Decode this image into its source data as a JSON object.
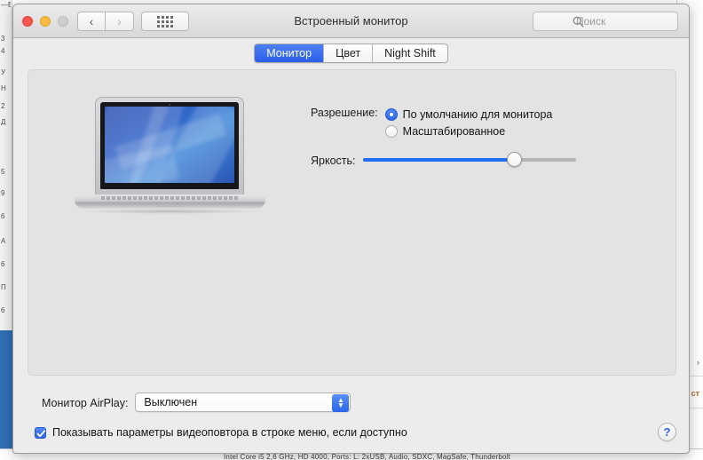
{
  "window": {
    "title": "Встроенный монитор",
    "traffic_lights": [
      "close",
      "minimize",
      "zoom"
    ],
    "nav": {
      "back_label": "‹",
      "forward_label": "›"
    },
    "grid_button_name": "show-all-preferences"
  },
  "search": {
    "placeholder": "Поиск",
    "icon": "search-icon"
  },
  "tabs": [
    {
      "label": "Монитор",
      "active": true
    },
    {
      "label": "Цвет",
      "active": false
    },
    {
      "label": "Night Shift",
      "active": false
    }
  ],
  "display_preview": {
    "device": "MacBook Pro",
    "wallpaper": "blue-abstract-waves"
  },
  "resolution": {
    "label": "Разрешение:",
    "options": [
      {
        "label": "По умолчанию для монитора",
        "selected": true
      },
      {
        "label": "Масштабированное",
        "selected": false
      }
    ]
  },
  "brightness": {
    "label": "Яркость:",
    "value_percent": 73,
    "min": 0,
    "max": 100
  },
  "airplay": {
    "label": "Монитор AirPlay:",
    "selected_value": "Выключен",
    "stepper_up_glyph": "▲",
    "stepper_down_glyph": "▼"
  },
  "mirroring_checkbox": {
    "label": "Показывать параметры видеоповтора в строке меню, если доступно",
    "checked": true
  },
  "help": {
    "label": "?"
  },
  "background": {
    "bottom_strip_text": "Intel Core i5 2,6 GHz, HD 4000, Ports: L: 2xUSB, Audio, SDXC, MagSafe, Thunderbolt",
    "sidebar_lines": [
      "—ВА",
      "3",
      "4",
      "У",
      "Н",
      "2",
      "Д",
      "",
      "5",
      "9",
      "6",
      "А",
      "6",
      "П",
      "6"
    ],
    "right_glyphs": [
      "›",
      "ст"
    ]
  },
  "colors": {
    "accent_blue": "#2f68e8",
    "slider_blue": "#1d6ef0",
    "tab_active": "#2b5fe8",
    "window_bg": "#ececec",
    "panel_bg": "#e3e3e3",
    "close_red": "#f9574e",
    "min_yellow": "#fdbc40",
    "zoom_gray": "#cecece"
  }
}
